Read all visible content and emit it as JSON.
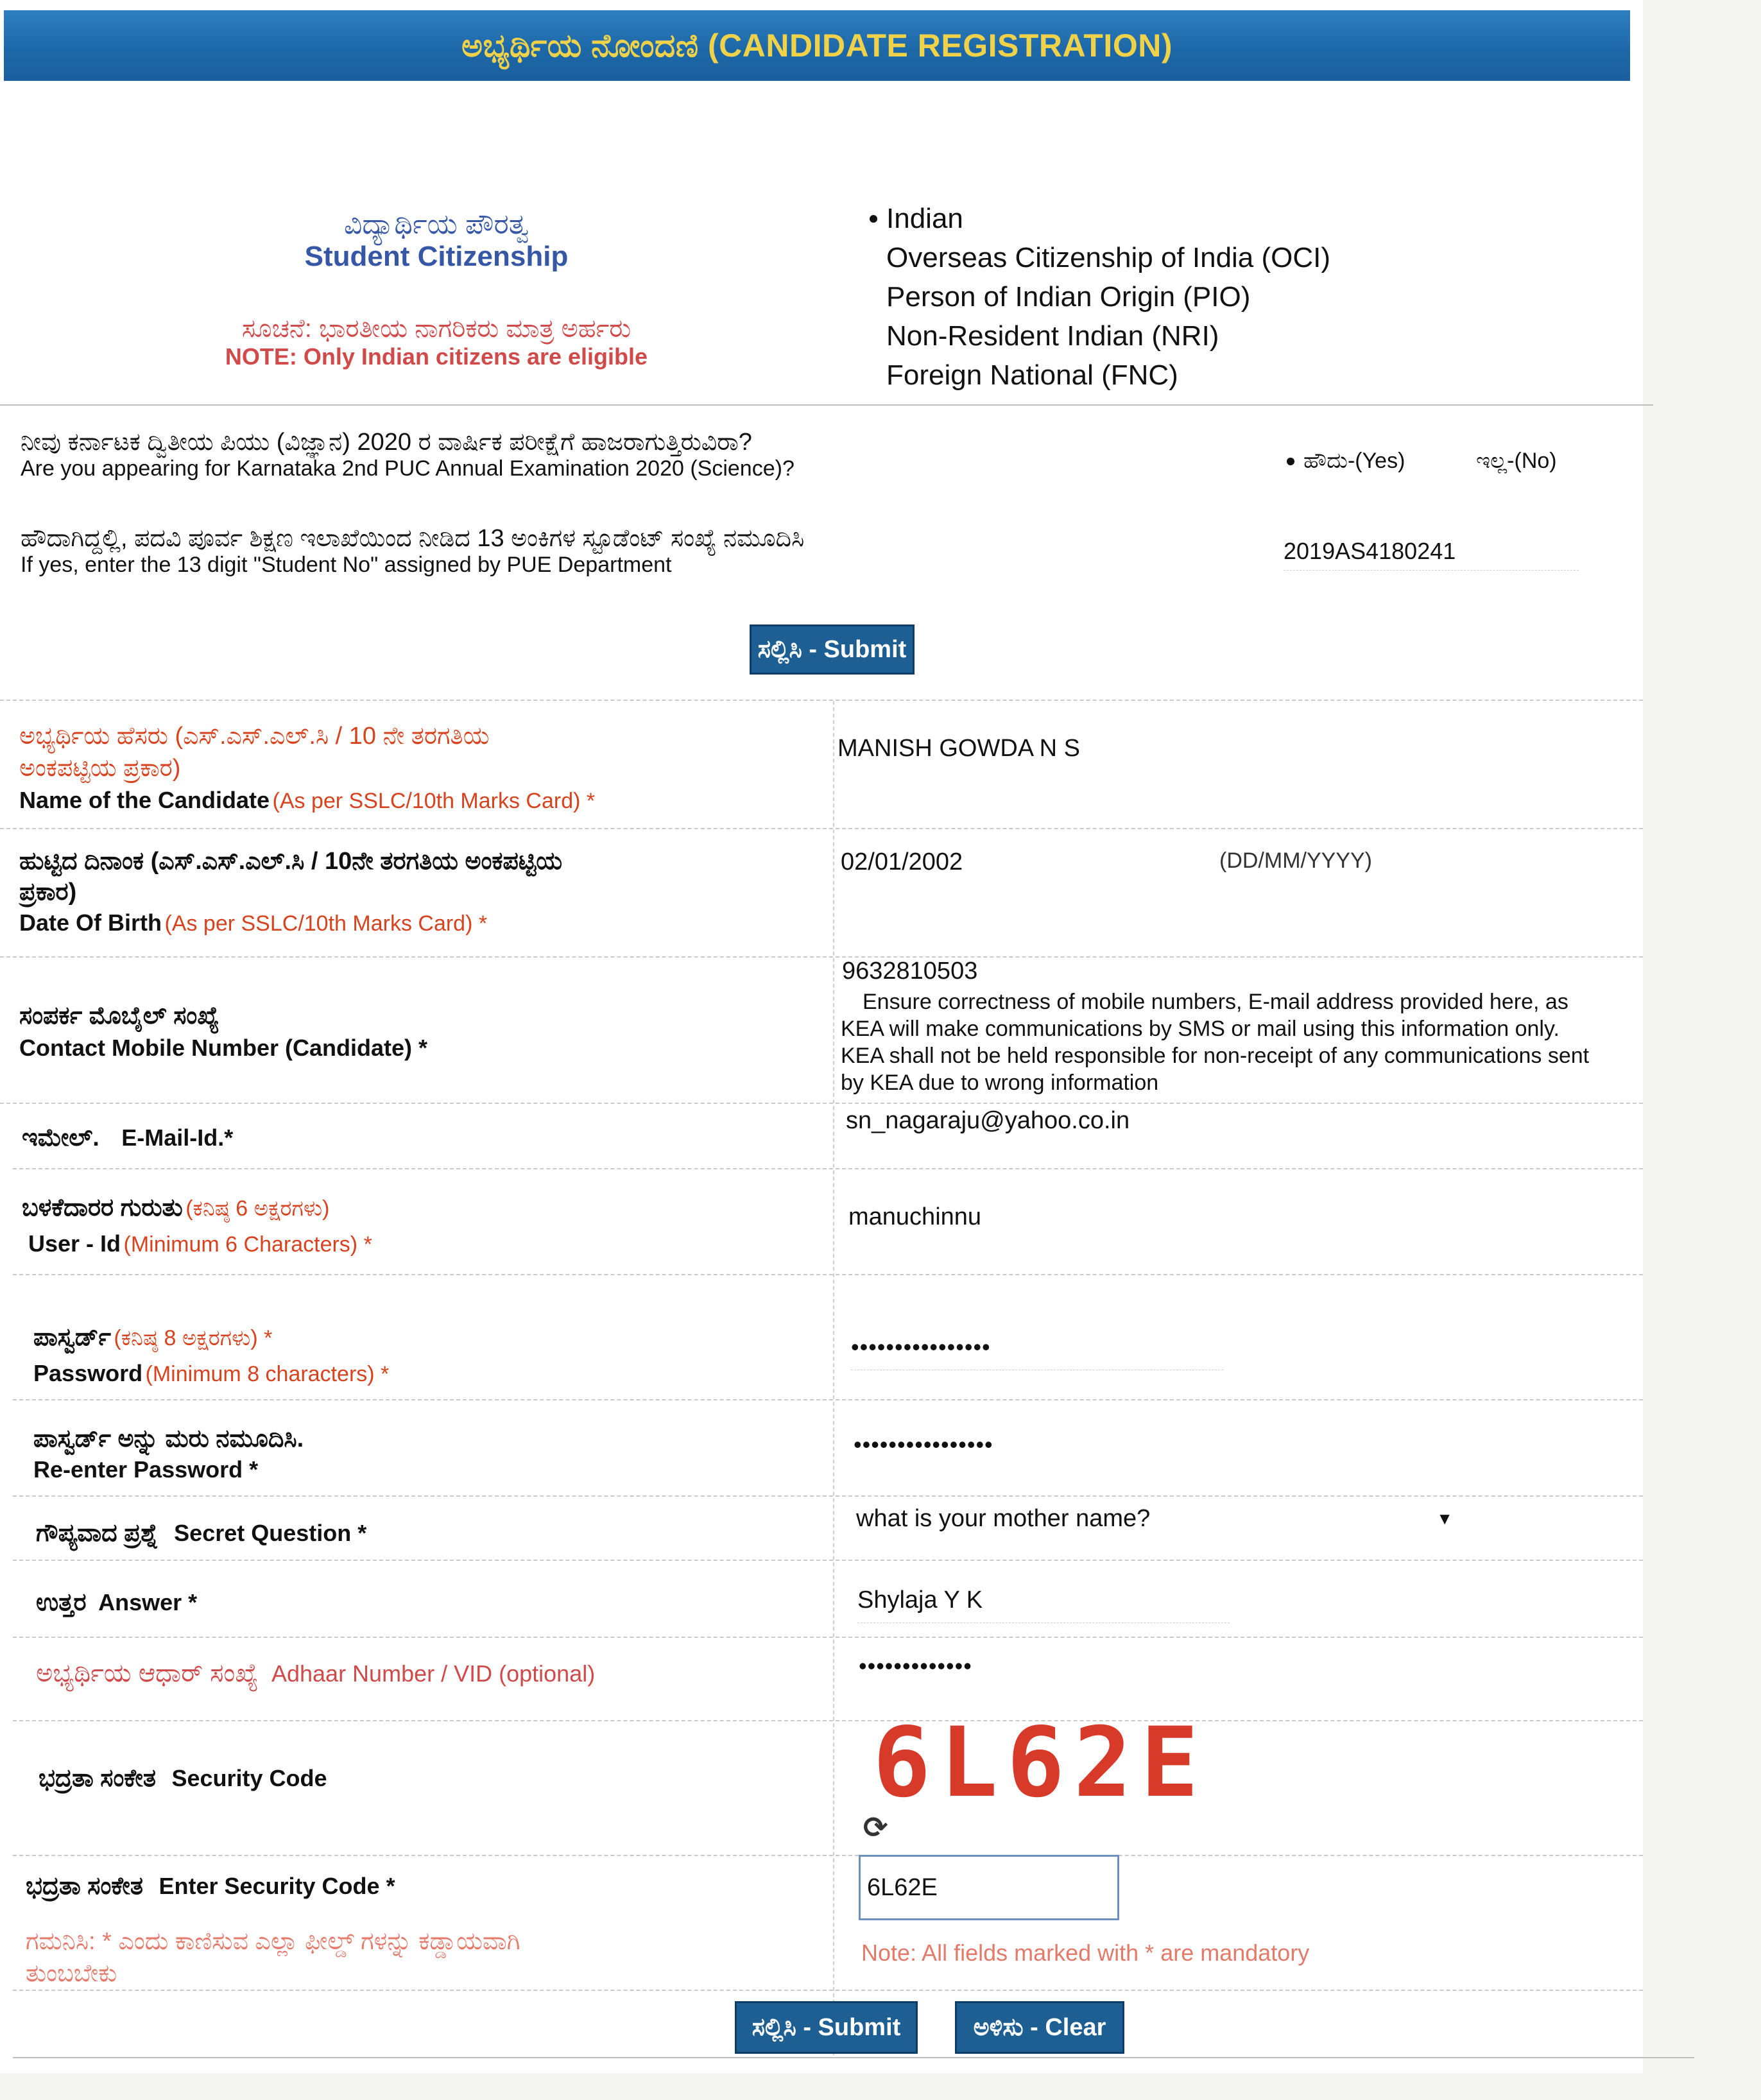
{
  "header": {
    "title": "ಅಭ್ಯರ್ಥಿಯ ನೋಂದಣಿ (CANDIDATE REGISTRATION)"
  },
  "citizenship": {
    "label_kn": "ವಿದ್ಯಾರ್ಥಿಯ ಪೌರತ್ವ",
    "label_en": "Student Citizenship",
    "note_kn": "ಸೂಚನೆ: ಭಾರತೀಯ ನಾಗರಿಕರು ಮಾತ್ರ ಅರ್ಹರು",
    "note_en": "NOTE: Only Indian citizens are eligible",
    "options": [
      "Indian",
      "Overseas Citizenship of India (OCI)",
      "Person of Indian Origin (PIO)",
      "Non-Resident Indian (NRI)",
      "Foreign National (FNC)"
    ],
    "selected_index": 0
  },
  "puc_question": {
    "q_kn": "ನೀವು ಕರ್ನಾಟಕ ದ್ವಿತೀಯ ಪಿಯು (ವಿಜ್ಞಾನ) 2020 ರ ವಾರ್ಷಿಕ ಪರೀಕ್ಷೆಗೆ ಹಾಜರಾಗುತ್ತಿರುವಿರಾ?",
    "q_en": "Are you appearing for Karnataka 2nd PUC Annual Examination 2020 (Science)?",
    "yes_label": "ಹೌದು-(Yes)",
    "no_label": "ಇಲ್ಲ-(No)"
  },
  "student_no": {
    "q_kn": "ಹೌದಾಗಿದ್ದಲ್ಲಿ, ಪದವಿ ಪೂರ್ವ ಶಿಕ್ಷಣ ಇಲಾಖೆಯಿಂದ ನೀಡಿದ 13 ಅಂಕಿಗಳ ಸ್ಟೂಡೆಂಟ್ ಸಂಖ್ಯೆ ನಮೂದಿಸಿ",
    "q_en": "If yes, enter the 13 digit \"Student No\" assigned by PUE Department",
    "value": "2019AS4180241"
  },
  "submit_top": "ಸಲ್ಲಿಸಿ - Submit",
  "fields": {
    "name": {
      "kn1": "ಅಭ್ಯರ್ಥಿಯ ಹೆಸರು (ಎಸ್.ಎಸ್.ಎಲ್.ಸಿ / 10 ನೇ ತರಗತಿಯ",
      "kn2": "ಅಂಕಪಟ್ಟಿಯ ಪ್ರಕಾರ)",
      "en": "Name of the Candidate",
      "en_red": "(As per SSLC/10th Marks Card) *",
      "value": "MANISH GOWDA N S"
    },
    "dob": {
      "kn1": "ಹುಟ್ಟಿದ ದಿನಾಂಕ (ಎಸ್.ಎಸ್.ಎಲ್.ಸಿ / 10ನೇ ತರಗತಿಯ ಅಂಕಪಟ್ಟಿಯ",
      "kn2": "ಪ್ರಕಾರ)",
      "en": "Date Of Birth",
      "en_red": "(As per SSLC/10th Marks Card) *",
      "value": "02/01/2002",
      "format": "(DD/MM/YYYY)"
    },
    "mobile": {
      "kn": "ಸಂಪರ್ಕ ಮೊಬೈಲ್ ಸಂಖ್ಯೆ",
      "en": "Contact Mobile Number (Candidate) *",
      "value": "9632810503",
      "hint1": "Ensure correctness of mobile numbers, E-mail address provided here, as",
      "hint2": "KEA will make communications by SMS or mail using this information only.",
      "hint3": "KEA shall not be held responsible for non-receipt of any communications sent",
      "hint4": "by KEA due to wrong information"
    },
    "email": {
      "kn": "ಇಮೇಲ್.",
      "en": "E-Mail-Id.*",
      "value": "sn_nagaraju@yahoo.co.in"
    },
    "userid": {
      "kn": "ಬಳಕೆದಾರರ ಗುರುತು",
      "kn_red": "(ಕನಿಷ್ಠ 6 ಅಕ್ಷರಗಳು)",
      "en": "User - Id",
      "en_red": "(Minimum 6 Characters) *",
      "value": "manuchinnu"
    },
    "password": {
      "kn": "ಪಾಸ್ವರ್ಡ್",
      "kn_red": "(ಕನಿಷ್ಠ 8 ಅಕ್ಷರಗಳು) *",
      "en": "Password",
      "en_red": "(Minimum 8 characters) *",
      "value": "••••••••••••••••"
    },
    "repassword": {
      "kn": "ಪಾಸ್ವರ್ಡ್ ಅನ್ನು ಮರು ನಮೂದಿಸಿ.",
      "en": "Re-enter Password *",
      "value": "••••••••••••••••"
    },
    "secret": {
      "kn": "ಗೌಪ್ಯವಾದ ಪ್ರಶ್ನೆ",
      "en": "Secret Question *",
      "value": "what is  your mother name?"
    },
    "answer": {
      "kn": "ಉತ್ತರ",
      "en": "Answer *",
      "value": "Shylaja Y K"
    },
    "aadhaar": {
      "kn": "ಅಭ್ಯರ್ಥಿಯ ಆಧಾರ್ ಸಂಖ್ಯೆ",
      "en": "Adhaar Number / VID (optional)",
      "value": "•••••••••••••"
    },
    "security": {
      "kn": "ಭದ್ರತಾ ಸಂಕೇತ",
      "en": "Security Code",
      "captcha": "6L62E"
    },
    "enter_security": {
      "kn": "ಭದ್ರತಾ ಸಂಕೇತ",
      "en": "Enter Security Code *",
      "value": "6L62E"
    }
  },
  "footer": {
    "note_kn1": "ಗಮನಿಸಿ: * ಎಂದು ಕಾಣಿಸುವ ಎಲ್ಲಾ ಫೀಲ್ಡ್ ಗಳನ್ನು ಕಡ್ಡಾಯವಾಗಿ",
    "note_kn2": "ತುಂಬಬೇಕು",
    "note_en": "Note: All fields marked with * are mandatory",
    "submit": "ಸಲ್ಲಿಸಿ - Submit",
    "clear": "ಅಳಿಸು - Clear"
  }
}
